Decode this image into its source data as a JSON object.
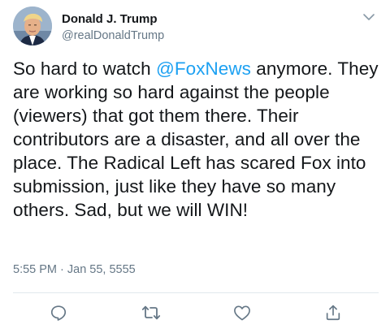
{
  "author": {
    "display_name": "Donald J. Trump",
    "handle": "@realDonaldTrump"
  },
  "tweet": {
    "text_before_mention": "So hard to watch ",
    "mention": "@FoxNews",
    "text_after_mention": " anymore. They are working so hard against the people (viewers) that got them there. Their contributors are a disaster, and all over the place. The Radical Left has scared Fox into submission, just like they have so many others. Sad, but we will WIN!",
    "timestamp": "5:55 PM · Jan 55, 5555"
  },
  "icons": {
    "menu": "chevron-down-icon",
    "reply": "reply-icon",
    "retweet": "retweet-icon",
    "like": "heart-icon",
    "share": "share-icon"
  },
  "colors": {
    "text": "#14171a",
    "secondary": "#657786",
    "mention": "#1da1f2",
    "divider": "#e1e8ed"
  }
}
